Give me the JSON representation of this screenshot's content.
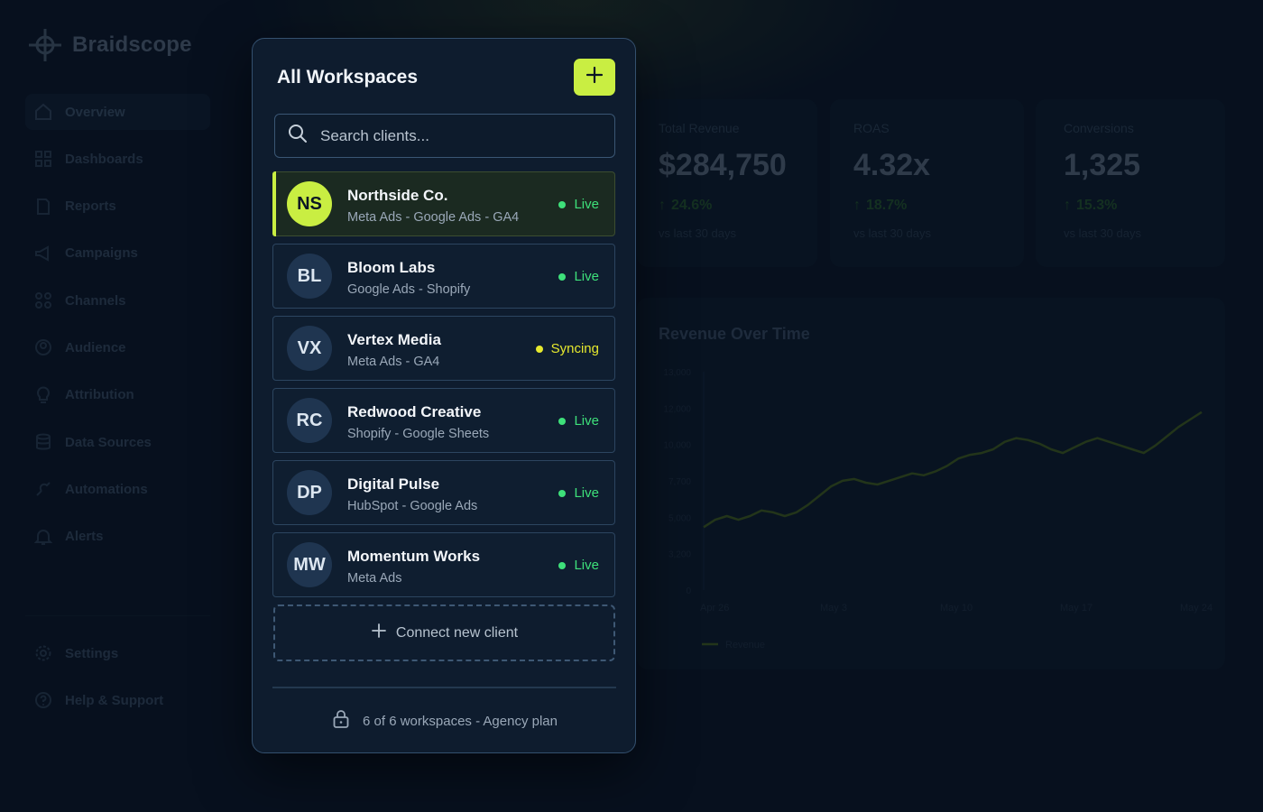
{
  "app": {
    "brand_name": "Braidscope"
  },
  "sidebar": {
    "items": [
      {
        "label": "Overview",
        "icon": "home-icon",
        "active": true
      },
      {
        "label": "Dashboards",
        "icon": "grid-icon"
      },
      {
        "label": "Reports",
        "icon": "document-icon"
      },
      {
        "label": "Campaigns",
        "icon": "megaphone-icon"
      },
      {
        "label": "Channels",
        "icon": "channels-icon"
      },
      {
        "label": "Audience",
        "icon": "user-circle-icon"
      },
      {
        "label": "Attribution",
        "icon": "bulb-icon"
      },
      {
        "label": "Data Sources",
        "icon": "database-icon"
      },
      {
        "label": "Automations",
        "icon": "automation-icon"
      },
      {
        "label": "Alerts",
        "icon": "bell-icon"
      }
    ],
    "bottom_items": [
      {
        "label": "Settings",
        "icon": "gear-icon"
      },
      {
        "label": "Help & Support",
        "icon": "help-icon"
      }
    ]
  },
  "stats": [
    {
      "label": "Total Revenue",
      "value": "$284,750",
      "change": "24.6%",
      "sub": "vs last 30 days"
    },
    {
      "label": "ROAS",
      "value": "4.32x",
      "change": "18.7%",
      "sub": "vs last 30 days"
    },
    {
      "label": "Conversions",
      "value": "1,325",
      "change": "15.3%",
      "sub": "vs last 30 days"
    }
  ],
  "chart": {
    "title": "Revenue Over Time",
    "legend": "Revenue"
  },
  "chart_data": {
    "type": "line",
    "title": "Revenue Over Time",
    "xlabel": "",
    "ylabel": "",
    "ytick_labels": [
      "0",
      "3,200",
      "5,000",
      "7,700",
      "10,000",
      "12,000",
      "13,000"
    ],
    "xtick_labels": [
      "Apr 26",
      "May 3",
      "May 10",
      "May 17",
      "May 24"
    ],
    "series": [
      {
        "name": "Revenue",
        "values": [
          0.29,
          0.33,
          0.35,
          0.33,
          0.35,
          0.38,
          0.37,
          0.35,
          0.37,
          0.41,
          0.46,
          0.51,
          0.54,
          0.55,
          0.53,
          0.52,
          0.54,
          0.56,
          0.58,
          0.57,
          0.59,
          0.62,
          0.66,
          0.68,
          0.69,
          0.71,
          0.75,
          0.77,
          0.76,
          0.74,
          0.71,
          0.69,
          0.72,
          0.75,
          0.77,
          0.75,
          0.73,
          0.71,
          0.69,
          0.73,
          0.78,
          0.83,
          0.87,
          0.91
        ]
      }
    ],
    "grid": false,
    "legend_position": "bottom-left"
  },
  "popover": {
    "title": "All Workspaces",
    "add_icon": "plus-icon",
    "search_placeholder": "Search clients...",
    "connect_label": "Connect new client",
    "footer_text": "6 of 6 workspaces - Agency plan",
    "footer_icon": "lock-icon"
  },
  "clients": [
    {
      "initials": "NS",
      "name": "Northside Co.",
      "sources": "Meta Ads - Google Ads - GA4",
      "status": "Live",
      "status_color": "#3ee07a",
      "selected": true
    },
    {
      "initials": "BL",
      "name": "Bloom Labs",
      "sources": "Google Ads - Shopify",
      "status": "Live",
      "status_color": "#3ee07a"
    },
    {
      "initials": "VX",
      "name": "Vertex Media",
      "sources": "Meta Ads - GA4",
      "status": "Syncing",
      "status_color": "#e6e92e"
    },
    {
      "initials": "RC",
      "name": "Redwood Creative",
      "sources": "Shopify - Google Sheets",
      "status": "Live",
      "status_color": "#3ee07a"
    },
    {
      "initials": "DP",
      "name": "Digital Pulse",
      "sources": "HubSpot - Google Ads",
      "status": "Live",
      "status_color": "#3ee07a"
    },
    {
      "initials": "MW",
      "name": "Momentum Works",
      "sources": "Meta Ads",
      "status": "Live",
      "status_color": "#3ee07a"
    }
  ],
  "colors": {
    "accent": "#c9ee42",
    "live": "#3ee07a",
    "syncing": "#e6e92e",
    "panel_bg": "#0e1c2e"
  }
}
